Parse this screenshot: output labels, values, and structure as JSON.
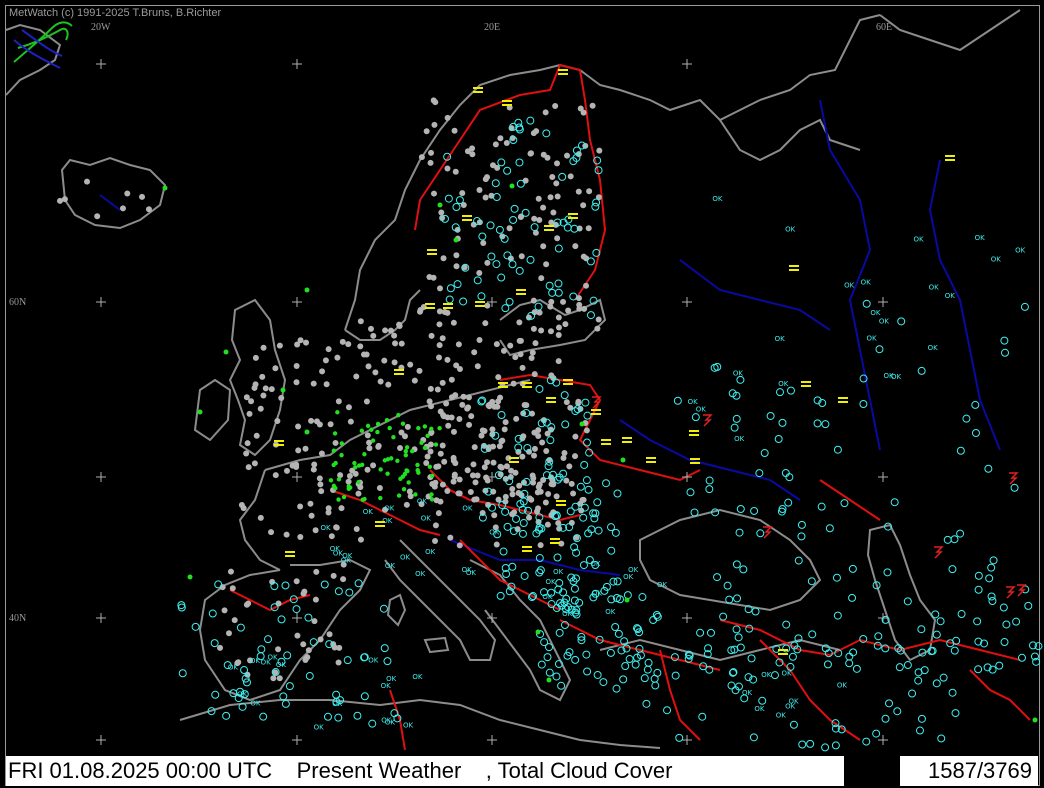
{
  "copyright": "MetWatch  (c) 1991-2025 T.Bruns, B.Richter",
  "grid_labels": {
    "lon_20w": "20W",
    "lon_20e": "20E",
    "lon_60e": "60E",
    "lat_60n": "60N",
    "lat_40n": "40N"
  },
  "status": {
    "datetime": "FRI 01.08.2025 00:00 UTC",
    "parameter": "Present Weather",
    "separator": ",",
    "overlay": "Total Cloud Cover",
    "count": "1587/3769"
  },
  "colors": {
    "background": "#000000",
    "coastline": "#8c8c8c",
    "borders": "#e01010",
    "rivers": "#0a0aa0",
    "cloud_cover": "#3ef0f0",
    "station_grey": "#b4b4b4",
    "fog_symbol": "#f0f000",
    "precip_symbol": "#20e020",
    "thunder_symbol": "#e02020"
  },
  "stations": {
    "ok_label": "OK"
  }
}
